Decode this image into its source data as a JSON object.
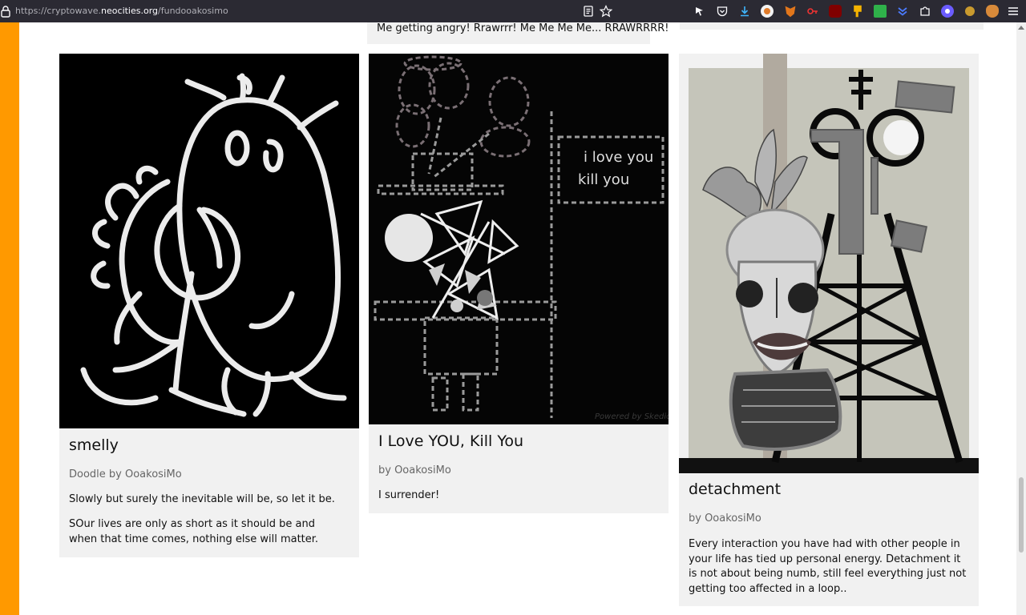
{
  "browser": {
    "url_prefix": "https://cryptowave.",
    "url_domain": "neocities.org",
    "url_path": "/fundooakosimo"
  },
  "top_partial_card": {
    "text": "Me getting angry! Rrawrrr! Me Me Me Me... RRAWRRRR!"
  },
  "cards": [
    {
      "title": "smelly",
      "byline": "Doodle by OoakosiMo",
      "desc": [
        "Slowly but surely the inevitable will be, so let it be.",
        "SOur lives are only as short as it should be and when that time comes, nothing else will matter."
      ]
    },
    {
      "title": "I Love YOU, Kill You",
      "byline": "by OoakosiMo",
      "image_text": [
        "i love you",
        "kill you"
      ],
      "watermark": "Powered by Skedio",
      "desc": [
        "I surrender!"
      ]
    },
    {
      "title": "detachment",
      "byline": "by OoakosiMo",
      "desc": [
        "Every interaction you have had with other people in your life has tied up personal energy. Detachment it is not about being numb, still feel everything just not getting too affected in a loop.."
      ]
    }
  ],
  "colors": {
    "accent_bar": "#ff9900",
    "card_bg": "#f1f1f1",
    "toolbar_bg": "#2b2a33"
  }
}
